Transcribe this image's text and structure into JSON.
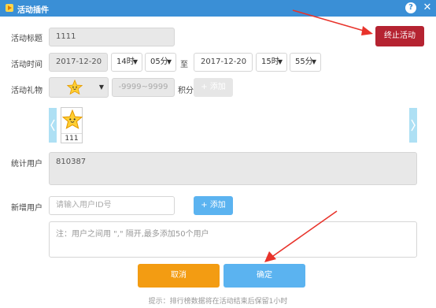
{
  "window": {
    "title": "活动插件",
    "help_label": "?",
    "close_label": "✕"
  },
  "form": {
    "name_label": "活动标题",
    "name_value": "1111",
    "time_label": "活动时间",
    "start_date": "2017-12-20",
    "start_hour": "14时",
    "start_min": "05分",
    "to_label": "至",
    "end_date": "2017-12-20",
    "end_hour": "15时",
    "end_min": "55分",
    "gift_label": "活动礼物",
    "points_placeholder": "-9999~9999",
    "points_unit": "积分",
    "gift_add_label": "+ 添加",
    "gift_items": [
      {
        "count": "111"
      }
    ],
    "stats_label": "统计用户",
    "stats_value": "810387",
    "new_user_label": "新增用户",
    "new_user_placeholder": "请输入用户ID号",
    "new_user_add_label": "+ 添加",
    "notes_placeholder": "注：用户之间用 \",\" 隔开,最多添加50个用户"
  },
  "actions": {
    "stop_label": "终止活动",
    "cancel_label": "取消",
    "confirm_label": "确定"
  },
  "footer": {
    "hint": "提示：排行榜数据将在活动结束后保留1小时"
  },
  "colors": {
    "titlebar": "#3a8fd6",
    "stop_button": "#b52331",
    "cancel_button": "#f39c12",
    "confirm_button": "#5bb3f0",
    "add_button": "#5bb3f0",
    "arrow": "#e8332b"
  }
}
